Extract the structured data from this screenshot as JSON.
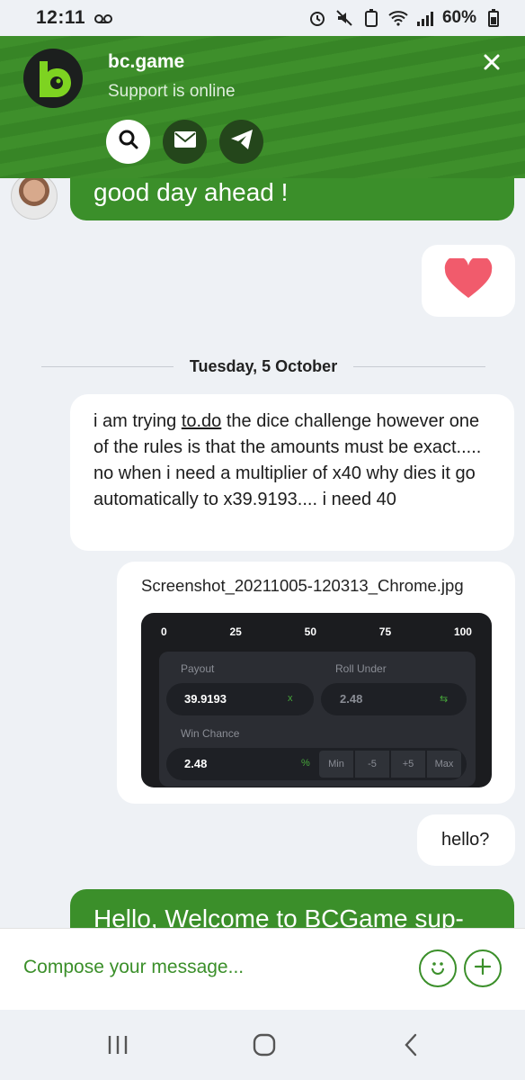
{
  "status_bar": {
    "time": "12:11",
    "battery": "60%"
  },
  "header": {
    "brand": "bc.game",
    "subtitle": "Support is online",
    "colors": {
      "accent": "#3b8f2a",
      "header_dark": "#24461b"
    }
  },
  "messages": {
    "top_partial": "good day ahead !",
    "reaction": "heart",
    "date_separator": "Tuesday, 5 October",
    "msg1": {
      "before": "i am trying ",
      "link": "to.do",
      "after": " the dice challenge however one of the rules is that the amounts must be exact..... no when i need a multiplier of x40 why dies it go automatically to x39.9193.... i need 40"
    },
    "attachment": {
      "filename": "Screenshot_20211005-120313_Chrome.jpg",
      "thumbnail": {
        "scale": [
          "0",
          "25",
          "50",
          "75",
          "100"
        ],
        "payout_label": "Payout",
        "payout_value": "39.9193",
        "payout_suffix": "x",
        "roll_under_label": "Roll Under",
        "roll_under_value": "2.48",
        "win_chance_label": "Win Chance",
        "win_chance_value": "2.48",
        "win_chance_suffix": "%",
        "buttons": [
          "Min",
          "-5",
          "+5",
          "Max"
        ]
      }
    },
    "hello": "hello?",
    "bottom_partial": "Hello, Welcome to BCGame sup-"
  },
  "compose": {
    "placeholder": "Compose your message..."
  }
}
